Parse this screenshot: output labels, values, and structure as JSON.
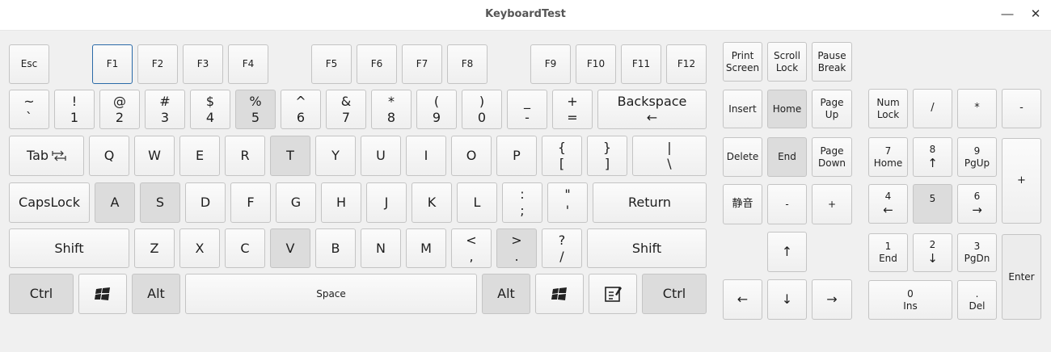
{
  "window": {
    "title": "KeyboardTest",
    "minimize_icon": "minimize-icon",
    "close_icon": "close-icon"
  },
  "keys": {
    "esc": "Esc",
    "f1": "F1",
    "f2": "F2",
    "f3": "F3",
    "f4": "F4",
    "f5": "F5",
    "f6": "F6",
    "f7": "F7",
    "f8": "F8",
    "f9": "F9",
    "f10": "F10",
    "f11": "F11",
    "f12": "F12",
    "print_screen": [
      "Print",
      "Screen"
    ],
    "scroll_lock": [
      "Scroll",
      "Lock"
    ],
    "pause_break": [
      "Pause",
      "Break"
    ],
    "grave": [
      "~",
      "`"
    ],
    "d1": [
      "!",
      "1"
    ],
    "d2": [
      "@",
      "2"
    ],
    "d3": [
      "#",
      "3"
    ],
    "d4": [
      "$",
      "4"
    ],
    "d5": [
      "%",
      "5"
    ],
    "d6": [
      "^",
      "6"
    ],
    "d7": [
      "&",
      "7"
    ],
    "d8": [
      "*",
      "8"
    ],
    "d9": [
      "(",
      "9"
    ],
    "d0": [
      ")",
      "0"
    ],
    "minus": [
      "_",
      "-"
    ],
    "equal": [
      "+",
      "="
    ],
    "backspace": [
      "Backspace",
      "←"
    ],
    "insert": "Insert",
    "home": "Home",
    "page_up": [
      "Page",
      "Up"
    ],
    "tab": "Tab",
    "tab_icon": "tab-arrows-icon",
    "q": "Q",
    "w": "W",
    "e": "E",
    "r": "R",
    "t": "T",
    "y": "Y",
    "u": "U",
    "i": "I",
    "o": "O",
    "p": "P",
    "lbracket": [
      "{",
      "["
    ],
    "rbracket": [
      "}",
      "]"
    ],
    "backslash": [
      "|",
      "\\"
    ],
    "delete": "Delete",
    "end": "End",
    "page_down": [
      "Page",
      "Down"
    ],
    "capslock": "CapsLock",
    "a": "A",
    "s": "S",
    "d": "D",
    "f": "F",
    "g": "G",
    "h": "H",
    "j": "J",
    "k": "K",
    "l": "L",
    "semicolon": [
      ":",
      ";"
    ],
    "quote": [
      "\"",
      "'"
    ],
    "return": "Return",
    "mute": "静音",
    "vol_down": "-",
    "vol_up": "+",
    "lshift": "Shift",
    "z": "Z",
    "x": "X",
    "c": "C",
    "v": "V",
    "b": "B",
    "n": "N",
    "m": "M",
    "comma": [
      "<",
      ","
    ],
    "period": [
      ">",
      "."
    ],
    "slash": [
      "?",
      "/"
    ],
    "rshift": "Shift",
    "up": "↑",
    "left": "←",
    "down": "↓",
    "right": "→",
    "lctrl": "Ctrl",
    "lwin_icon": "windows-logo-icon",
    "lalt": "Alt",
    "space": "Space",
    "ralt": "Alt",
    "rwin_icon": "windows-logo-icon",
    "menu_icon": "context-menu-icon",
    "rctrl": "Ctrl",
    "numlock": [
      "Num",
      "Lock"
    ],
    "np_div": "/",
    "np_mul": "*",
    "np_sub": "-",
    "np7": [
      "7",
      "Home"
    ],
    "np8": [
      "8",
      "↑"
    ],
    "np9": [
      "9",
      "PgUp"
    ],
    "np_add": "+",
    "np4": [
      "4",
      "←"
    ],
    "np5": "5",
    "np6": [
      "6",
      "→"
    ],
    "np1": [
      "1",
      "End"
    ],
    "np2": [
      "2",
      "↓"
    ],
    "np3": [
      "3",
      "PgDn"
    ],
    "np_enter": "Enter",
    "np0": [
      "0",
      "Ins"
    ],
    "np_dec": [
      ".",
      "Del"
    ]
  },
  "state": {
    "pressed_keys": [
      "%5",
      "T",
      "A",
      "S",
      "V",
      "Home",
      "End",
      "Ctrl",
      "Alt",
      "Numpad 5"
    ],
    "focused_key": "F1"
  }
}
